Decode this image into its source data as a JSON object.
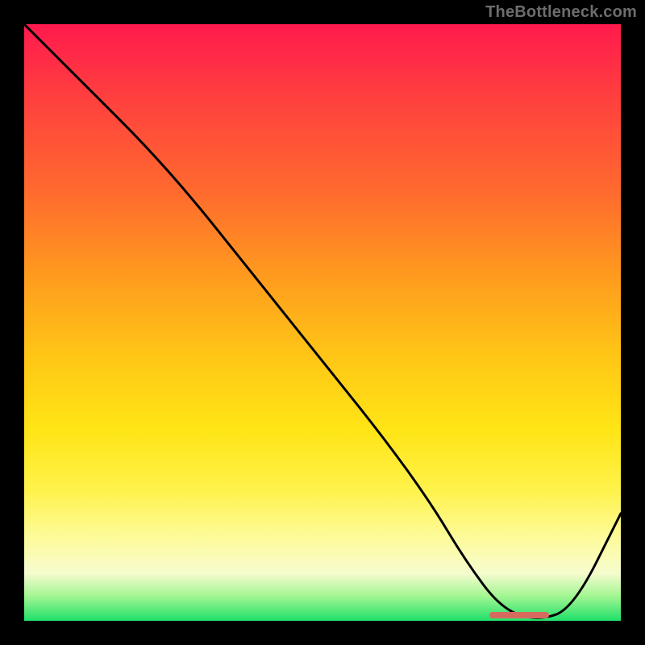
{
  "watermark": "TheBottleneck.com",
  "chart_data": {
    "type": "line",
    "title": "",
    "xlabel": "",
    "ylabel": "",
    "xlim": [
      0,
      100
    ],
    "ylim": [
      0,
      100
    ],
    "x": [
      0,
      5,
      12,
      20,
      28,
      36,
      44,
      52,
      60,
      68,
      74,
      80,
      86,
      92,
      100
    ],
    "y": [
      100,
      95,
      88,
      80,
      71,
      61,
      51,
      41,
      31,
      20,
      10,
      2,
      0,
      2,
      18
    ],
    "annotations": [
      {
        "kind": "marker-band",
        "x_start": 78,
        "x_end": 88,
        "y": 1
      }
    ],
    "background_gradient": {
      "type": "vertical",
      "stops": [
        {
          "pos": 0.0,
          "color": "#ff1a4d"
        },
        {
          "pos": 0.12,
          "color": "#ff3f3f"
        },
        {
          "pos": 0.28,
          "color": "#ff6a2e"
        },
        {
          "pos": 0.42,
          "color": "#ff9a1e"
        },
        {
          "pos": 0.55,
          "color": "#ffc416"
        },
        {
          "pos": 0.68,
          "color": "#ffe516"
        },
        {
          "pos": 0.78,
          "color": "#fff24a"
        },
        {
          "pos": 0.86,
          "color": "#fdfb9a"
        },
        {
          "pos": 0.92,
          "color": "#f7fccf"
        },
        {
          "pos": 0.96,
          "color": "#9ff590"
        },
        {
          "pos": 1.0,
          "color": "#1fe06a"
        }
      ]
    }
  }
}
